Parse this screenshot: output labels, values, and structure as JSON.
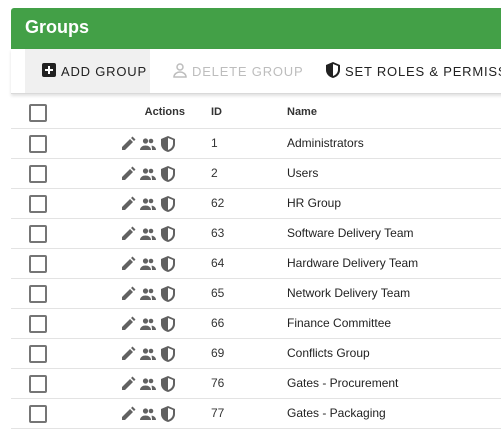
{
  "header": {
    "title": "Groups"
  },
  "toolbar": {
    "add_label": "ADD GROUP",
    "delete_label": "DELETE GROUP",
    "roles_label": "SET ROLES & PERMISSI"
  },
  "table": {
    "columns": {
      "actions": "Actions",
      "id": "ID",
      "name": "Name"
    },
    "rows": [
      {
        "id": "1",
        "name": "Administrators"
      },
      {
        "id": "2",
        "name": "Users"
      },
      {
        "id": "62",
        "name": "HR Group"
      },
      {
        "id": "63",
        "name": "Software Delivery Team"
      },
      {
        "id": "64",
        "name": "Hardware Delivery Team"
      },
      {
        "id": "65",
        "name": "Network Delivery Team"
      },
      {
        "id": "66",
        "name": "Finance Committee"
      },
      {
        "id": "69",
        "name": "Conflicts Group"
      },
      {
        "id": "76",
        "name": "Gates - Procurement"
      },
      {
        "id": "77",
        "name": "Gates - Packaging"
      }
    ]
  },
  "colors": {
    "header_bg": "#43a047",
    "icon": "#616161",
    "disabled": "#bdbdbd"
  },
  "icons": [
    "add-box-icon",
    "person-remove-icon",
    "shield-icon",
    "pencil-icon",
    "people-icon"
  ]
}
